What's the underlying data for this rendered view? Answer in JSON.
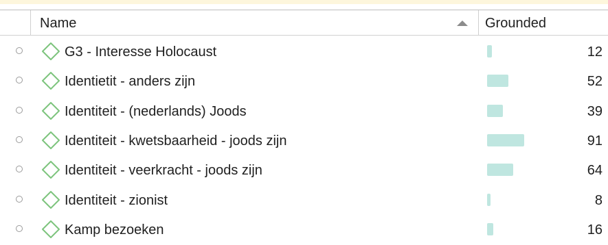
{
  "table": {
    "columns": {
      "name": "Name",
      "grounded": "Grounded"
    },
    "sort": {
      "column": "Name",
      "direction": "ascending"
    },
    "colors": {
      "bar": "#bfe6e0",
      "code_icon": "#7dc47d"
    },
    "max_grounded": 91,
    "rows": [
      {
        "label": "G3 - Interesse Holocaust",
        "grounded": "12",
        "grounded_value": 12,
        "icon": "diamond-icon"
      },
      {
        "label": "Identietit - anders zijn",
        "grounded": "52",
        "grounded_value": 52,
        "icon": "diamond-icon"
      },
      {
        "label": "Identiteit - (nederlands) Joods",
        "grounded": "39",
        "grounded_value": 39,
        "icon": "diamond-icon"
      },
      {
        "label": "Identiteit - kwetsbaarheid - joods zijn",
        "grounded": "91",
        "grounded_value": 91,
        "icon": "diamond-icon"
      },
      {
        "label": "Identiteit - veerkracht - joods zijn",
        "grounded": "64",
        "grounded_value": 64,
        "icon": "diamond-icon"
      },
      {
        "label": "Identiteit - zionist",
        "grounded": "8",
        "grounded_value": 8,
        "icon": "diamond-icon"
      },
      {
        "label": "Kamp bezoeken",
        "grounded": "16",
        "grounded_value": 16,
        "icon": "diamond-icon"
      }
    ]
  }
}
